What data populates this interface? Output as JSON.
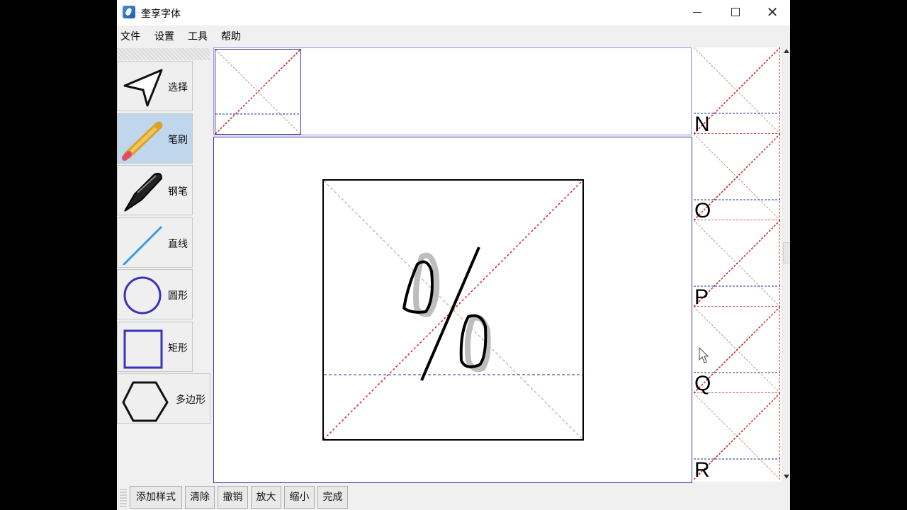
{
  "window": {
    "title": "奎享字体"
  },
  "menu": [
    "文件",
    "设置",
    "工具",
    "帮助"
  ],
  "tools": [
    {
      "label": "选择",
      "icon": "cursor-arrow-icon",
      "active": false
    },
    {
      "label": "笔刷",
      "icon": "pencil-icon",
      "active": true
    },
    {
      "label": "钢笔",
      "icon": "fountain-pen-icon",
      "active": false
    },
    {
      "label": "直线",
      "icon": "line-icon",
      "active": false
    },
    {
      "label": "圆形",
      "icon": "circle-icon",
      "active": false
    },
    {
      "label": "矩形",
      "icon": "rectangle-icon",
      "active": false
    },
    {
      "label": "多边形",
      "icon": "hexagon-icon",
      "active": false
    }
  ],
  "editor": {
    "glyph": "%"
  },
  "glyph_list": [
    "N",
    "O",
    "P",
    "Q",
    "R"
  ],
  "bottom_buttons": [
    "添加样式",
    "清除",
    "撤销",
    "放大",
    "缩小",
    "完成"
  ],
  "colors": {
    "grid_diagonal_red": "#cc2222",
    "grid_diagonal_gray": "#b59a8a",
    "baseline_blue": "#1a3a8a",
    "active_tool_bg": "#bfd6ec",
    "shape_stroke": "#3a32b8"
  }
}
